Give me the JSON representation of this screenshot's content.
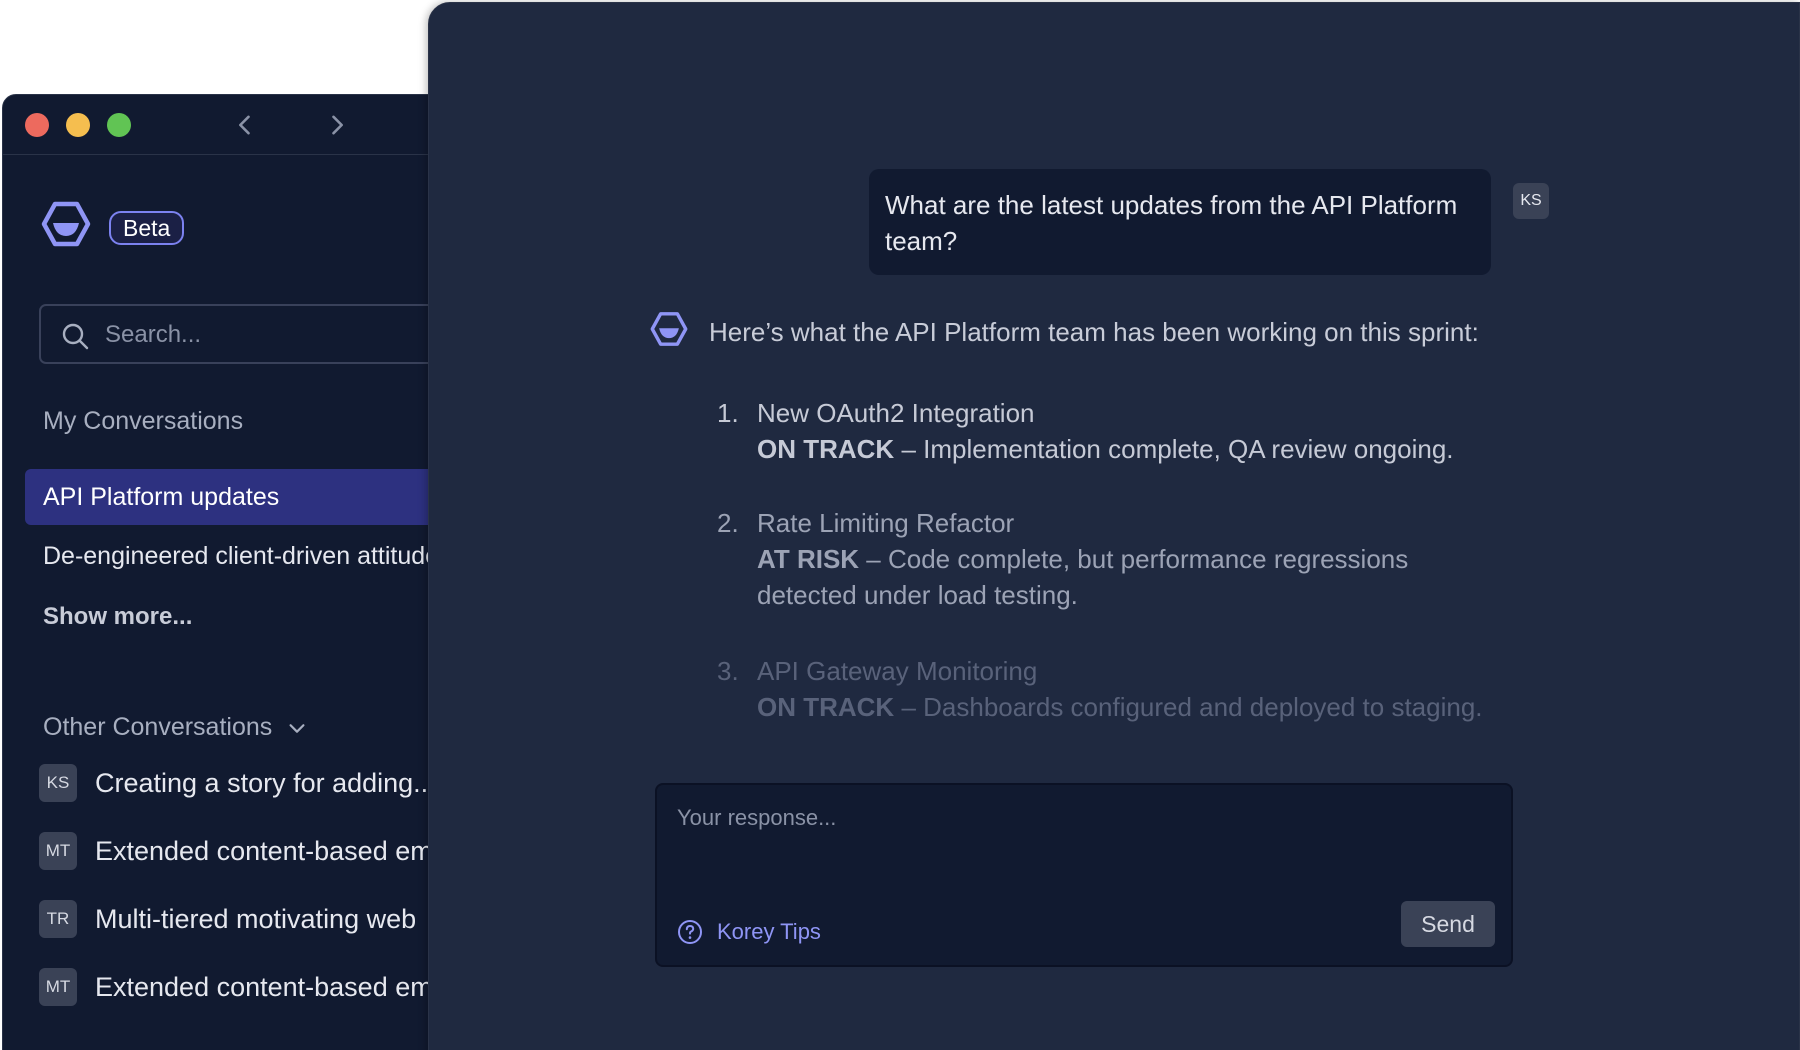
{
  "sidebar": {
    "badge": "Beta",
    "search": {
      "placeholder": "Search..."
    },
    "my_conversations": {
      "title": "My Conversations",
      "active": "API Platform updates",
      "items": [
        "De-engineered client-driven attitude"
      ],
      "show_more": "Show more..."
    },
    "other_conversations": {
      "title": "Other Conversations",
      "items": [
        {
          "initials": "KS",
          "label": "Creating a story for adding..."
        },
        {
          "initials": "MT",
          "label": "Extended content-based emulation"
        },
        {
          "initials": "TR",
          "label": "Multi-tiered motivating web"
        },
        {
          "initials": "MT",
          "label": "Extended content-based emulation"
        }
      ]
    }
  },
  "chat": {
    "user_message": "What are the latest updates from the API Platform team?",
    "user_initials": "KS",
    "bot_intro": "Here’s what the API Platform team has been working on this sprint:",
    "updates": [
      {
        "num": "1.",
        "title": "New OAuth2 Integration",
        "status": "ON TRACK",
        "detail": " – Implementation complete, QA review ongoing."
      },
      {
        "num": "2.",
        "title": "Rate Limiting Refactor",
        "status": "AT RISK",
        "detail": " – Code complete, but performance regressions detected under load testing."
      },
      {
        "num": "3.",
        "title": "API Gateway Monitoring",
        "status": "ON TRACK",
        "detail": " – Dashboards configured and deployed to staging."
      }
    ],
    "response": {
      "placeholder": "Your response...",
      "value": ""
    },
    "tips_label": "Korey Tips",
    "send_label": "Send"
  },
  "icons": {
    "logo": "hexagon-logo-icon",
    "back": "chevron-left-icon",
    "forward": "chevron-right-icon",
    "search": "search-icon",
    "expand": "chevron-down-icon",
    "help": "question-circle-icon"
  },
  "colors": {
    "accent": "#7c82f0",
    "active_conversation": "#2d3180",
    "sidebar_bg": "#111a30",
    "chat_bg": "#1f2940"
  }
}
